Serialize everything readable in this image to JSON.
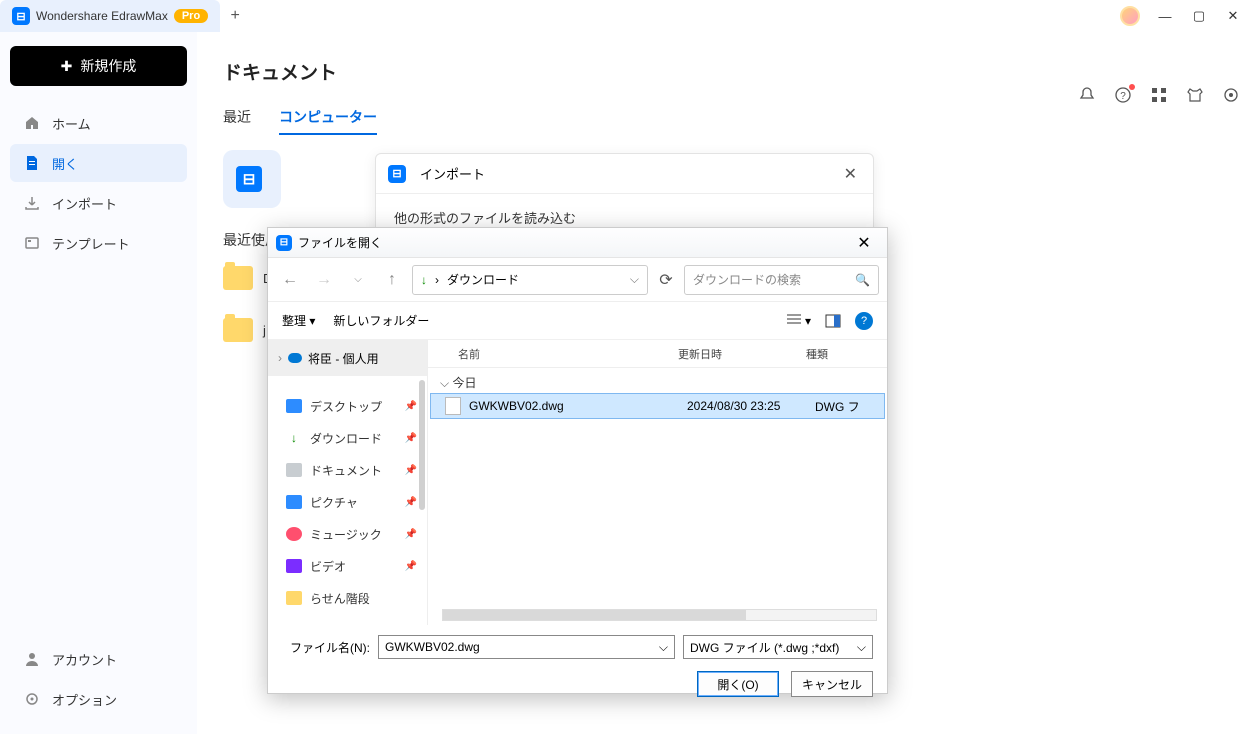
{
  "titlebar": {
    "app": "Wondershare EdrawMax",
    "pro": "Pro"
  },
  "sidebar": {
    "new": "新規作成",
    "home": "ホーム",
    "open": "開く",
    "import": "インポート",
    "template": "テンプレート",
    "account": "アカウント",
    "options": "オプション"
  },
  "main": {
    "title": "ドキュメント",
    "tab_recent": "最近",
    "tab_computer": "コンピューター",
    "recent_hdr": "最近使用"
  },
  "import_panel": {
    "title": "インポート",
    "subtitle": "他の形式のファイルを読み込む"
  },
  "file_open": {
    "title": "ファイルを開く",
    "breadcrumb": "ダウンロード",
    "search_placeholder": "ダウンロードの検索",
    "organize": "整理",
    "new_folder": "新しいフォルダー",
    "tree_top": "将臣 - 個人用",
    "tree": {
      "desktop": "デスクトップ",
      "downloads": "ダウンロード",
      "documents": "ドキュメント",
      "pictures": "ピクチャ",
      "music": "ミュージック",
      "video": "ビデオ",
      "spiral": "らせん階段"
    },
    "cols": {
      "name": "名前",
      "date": "更新日時",
      "type": "種類"
    },
    "group_today": "今日",
    "file": {
      "name": "GWKWBV02.dwg",
      "date": "2024/08/30 23:25",
      "type": "DWG フ"
    },
    "filename_label": "ファイル名(N):",
    "filename_value": "GWKWBV02.dwg",
    "filetype": "DWG ファイル (*.dwg ;*dxf)",
    "open_btn": "開く(O)",
    "cancel_btn": "キャンセル"
  }
}
